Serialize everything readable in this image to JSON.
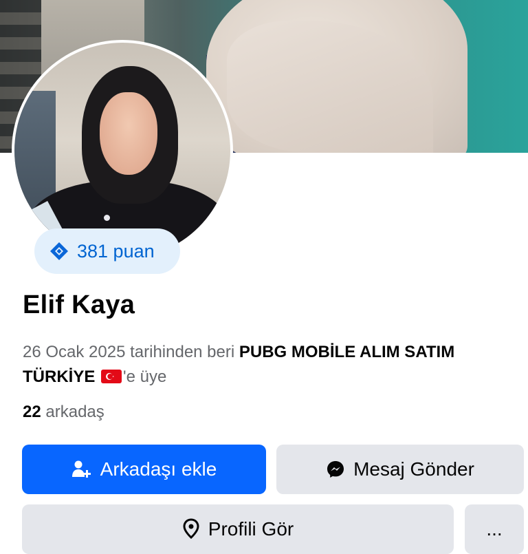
{
  "profile": {
    "name": "Elif Kaya",
    "points_label": "381 puan",
    "member_prefix": "26 Ocak 2025 tarihinden beri",
    "group_name": "PUBG MOBİLE ALIM SATIM TÜRKİYE",
    "flag_icon": "turkey-flag-icon",
    "member_suffix": "'e üye",
    "friends_count": "22",
    "friends_label": "arkadaş"
  },
  "actions": {
    "add_friend_label": "Arkadaşı ekle",
    "add_friend_icon": "add-person-icon",
    "message_label": "Mesaj Gönder",
    "message_icon": "messenger-icon",
    "view_profile_label": "Profili Gör",
    "view_profile_icon": "location-pin-icon",
    "more_label": "...",
    "more_icon": "more-icon"
  },
  "colors": {
    "primary_button": "#0866ff",
    "secondary_button": "#e4e6eb",
    "points_badge_bg": "#e3f0fc",
    "points_text": "#0064d1",
    "secondary_text": "#65676b"
  }
}
